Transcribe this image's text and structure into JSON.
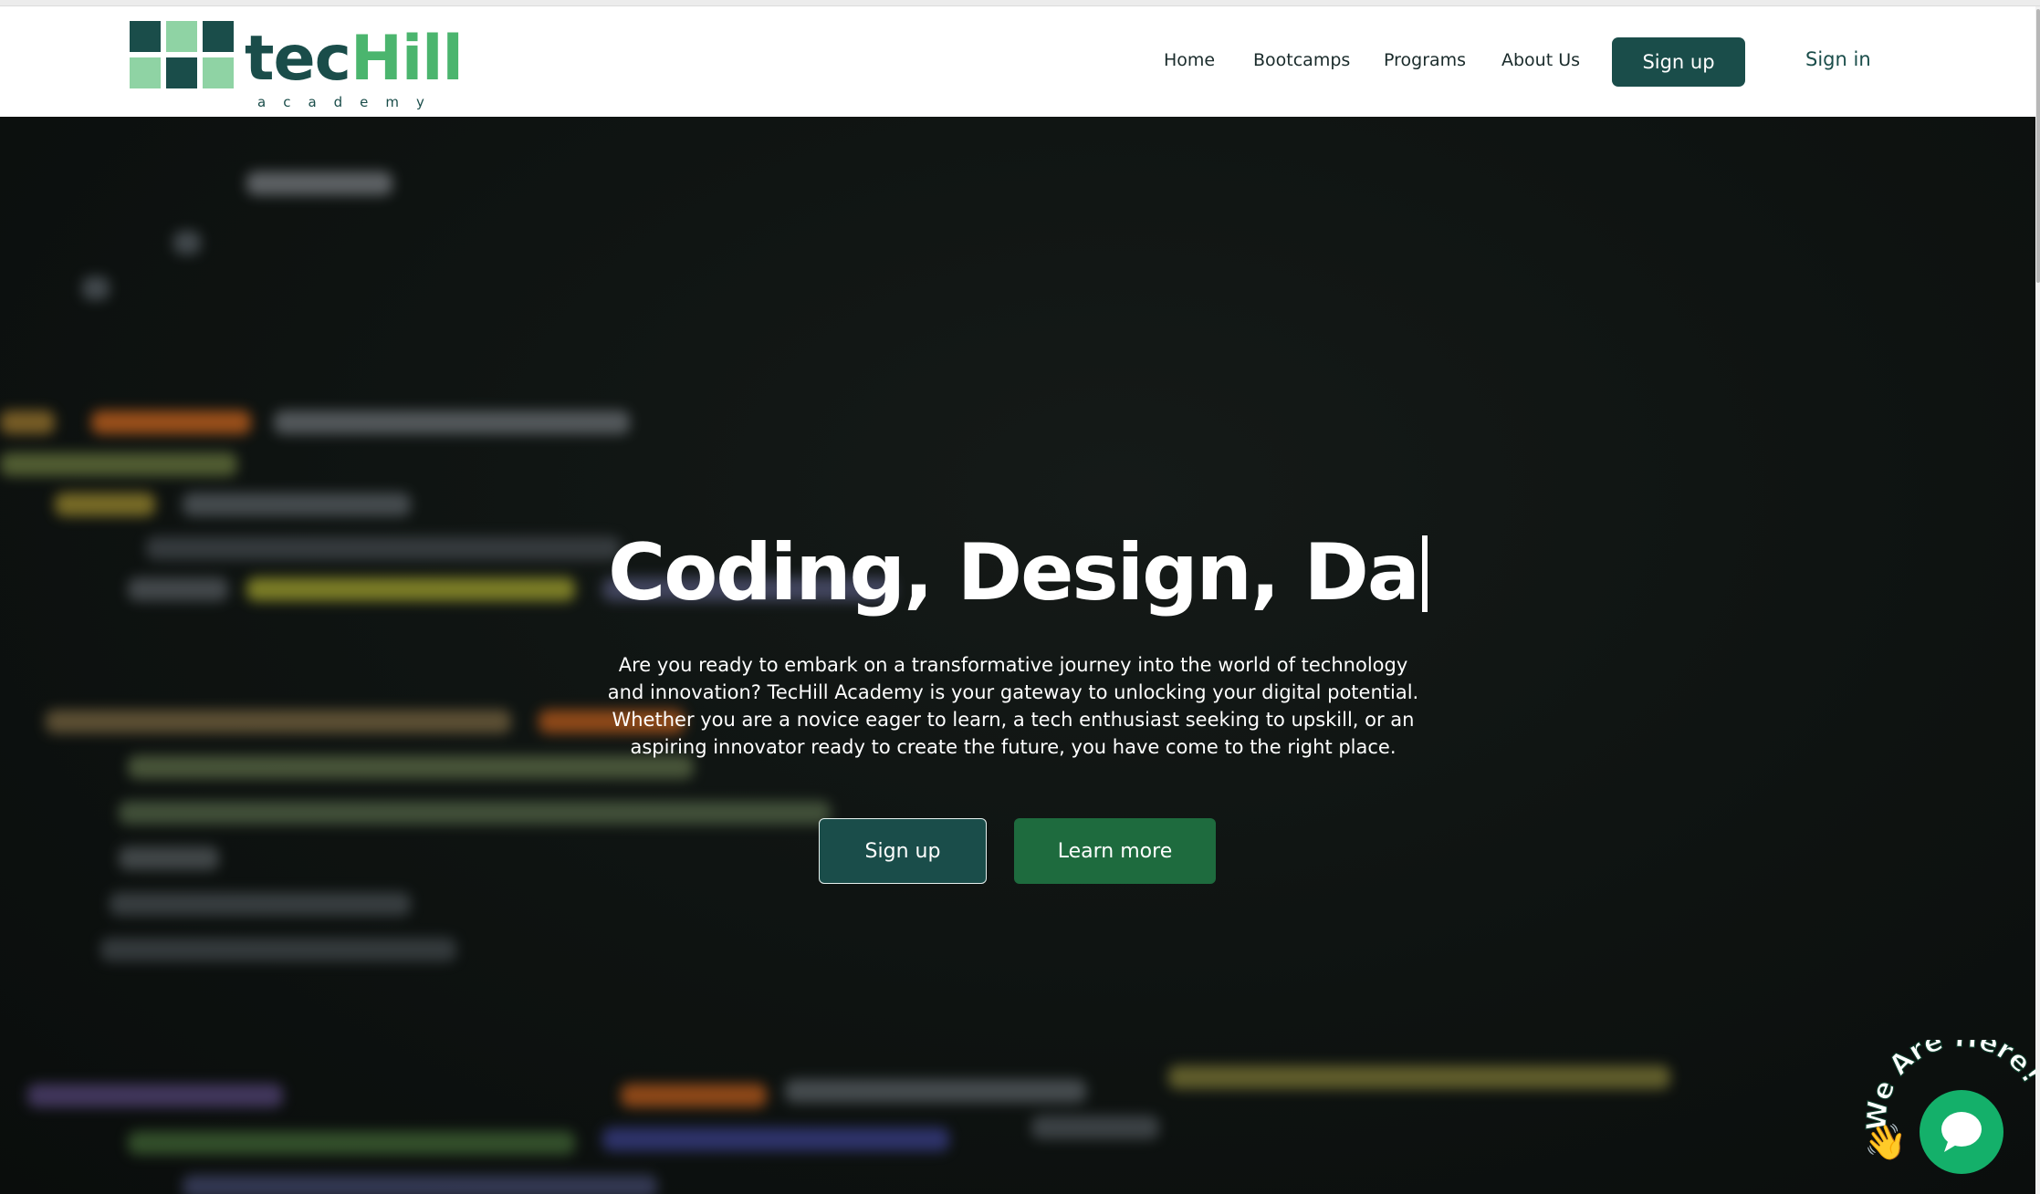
{
  "brand": {
    "name_part1": "tec",
    "name_part2": "Hill",
    "tagline": "academy",
    "colors": {
      "dark": "#1a4d4a",
      "green": "#4bb56e",
      "light_green": "#8fd3a4"
    }
  },
  "nav": {
    "links": [
      "Home",
      "Bootcamps",
      "Programs",
      "About Us"
    ],
    "signup_label": "Sign up",
    "signin_label": "Sign in"
  },
  "hero": {
    "title": "Coding, Design, Da",
    "description": "Are you ready to embark on a transformative journey into the world of technology and innovation? TecHill Academy is your gateway to unlocking your digital potential. Whether you are a novice eager to learn, a tech enthusiast seeking to upskill, or an aspiring innovator ready to create the future, you have come to the right place.",
    "primary_button": "Sign up",
    "secondary_button": "Learn more",
    "background_icon": "blurred-code-background"
  },
  "chat": {
    "label": "We Are Here!",
    "icon": "chat-bubble-icon",
    "wave_icon": "waving-hand-icon",
    "color": "#14b06a"
  }
}
